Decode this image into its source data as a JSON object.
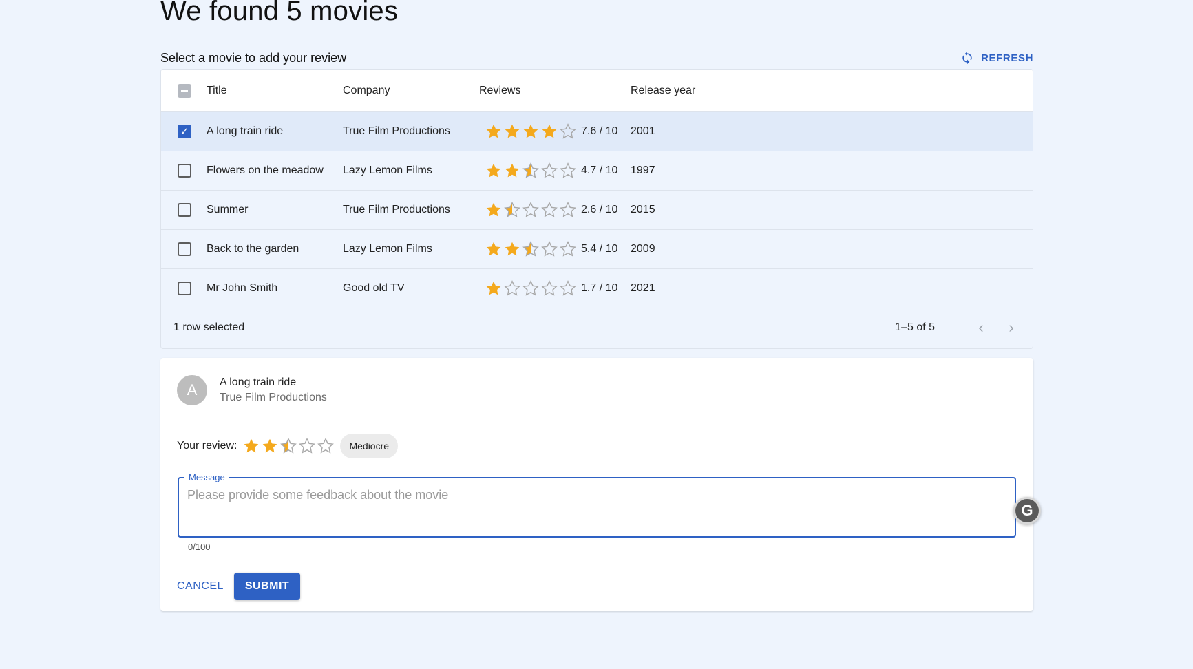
{
  "page": {
    "title": "We found 5 movies",
    "subtitle": "Select a movie to add your review",
    "refresh_label": "REFRESH"
  },
  "table": {
    "headers": [
      "Title",
      "Company",
      "Reviews",
      "Release year"
    ],
    "rows": [
      {
        "title": "A long train ride",
        "company": "True Film Productions",
        "stars": 4,
        "rating": "7.6 / 10",
        "year": "2001",
        "selected": true
      },
      {
        "title": "Flowers on the meadow",
        "company": "Lazy Lemon Films",
        "stars": 2.5,
        "rating": "4.7 / 10",
        "year": "1997",
        "selected": false
      },
      {
        "title": "Summer",
        "company": "True Film Productions",
        "stars": 1.5,
        "rating": "2.6 / 10",
        "year": "2015",
        "selected": false
      },
      {
        "title": "Back to the garden",
        "company": "Lazy Lemon Films",
        "stars": 2.5,
        "rating": "5.4 / 10",
        "year": "2009",
        "selected": false
      },
      {
        "title": "Mr John Smith",
        "company": "Good old TV",
        "stars": 1,
        "rating": "1.7 / 10",
        "year": "2021",
        "selected": false
      }
    ],
    "footer": {
      "selection": "1 row selected",
      "range": "1–5 of 5"
    }
  },
  "review": {
    "avatar_letter": "A",
    "movie_title": "A long train ride",
    "movie_company": "True Film Productions",
    "label": "Your review:",
    "stars": 2.5,
    "chip": "Mediocre",
    "message_label": "Message",
    "message_value": "",
    "message_placeholder": "Please provide some feedback about the movie",
    "char_count": "0/100",
    "cancel_label": "CANCEL",
    "submit_label": "SUBMIT"
  },
  "colors": {
    "accent": "#2e61c4",
    "star_filled": "#f4a91d",
    "star_empty": "#a8a8a8",
    "background": "#eef4fd"
  },
  "icons": {
    "refresh": "refresh-icon",
    "grammarly": "grammarly-icon"
  }
}
